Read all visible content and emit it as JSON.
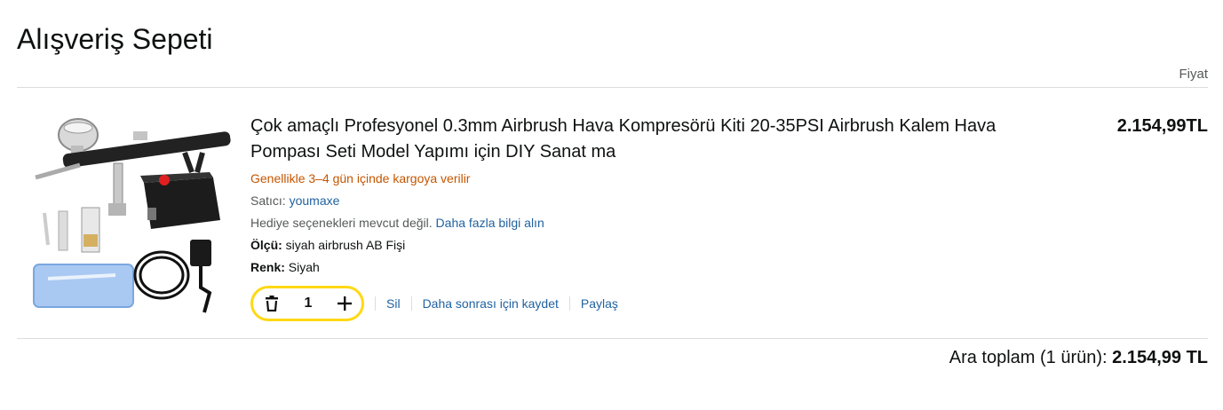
{
  "page": {
    "title": "Alışveriş Sepeti",
    "price_header": "Fiyat"
  },
  "item": {
    "title": "Çok amaçlı Profesyonel 0.3mm Airbrush Hava Kompresörü Kiti 20-35PSI Airbrush Kalem Hava Pompası Seti Model Yapımı için DIY Sanat ma",
    "shipping": "Genellikle 3–4 gün içinde kargoya verilir",
    "seller_label": "Satıcı:",
    "seller_name": "youmaxe",
    "gift_text": "Hediye seçenekleri mevcut değil.",
    "gift_link": "Daha fazla bilgi alın",
    "size_label": "Ölçü:",
    "size_value": "siyah airbrush AB Fişi",
    "color_label": "Renk:",
    "color_value": "Siyah",
    "price": "2.154,99TL",
    "quantity": "1",
    "image_icon": "airbrush-kit-product-image"
  },
  "actions": {
    "delete": "Sil",
    "save_later": "Daha sonrası için kaydet",
    "share": "Paylaş",
    "trash_icon": "trash-icon",
    "plus_icon": "plus-icon"
  },
  "subtotal": {
    "label": "Ara toplam (1 ürün):",
    "value": "2.154,99 TL"
  },
  "colors": {
    "link": "#2162a1",
    "shipping": "#c45500",
    "qty_border": "#ffd814",
    "divider": "#dddddd"
  }
}
